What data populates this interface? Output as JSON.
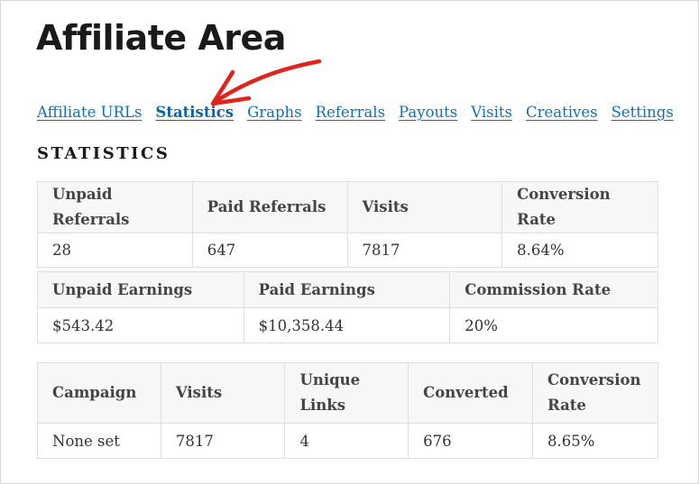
{
  "page": {
    "title": "Affiliate Area",
    "section_heading": "STATISTICS"
  },
  "tabs": [
    {
      "label": "Affiliate URLs",
      "active": false
    },
    {
      "label": "Statistics",
      "active": true
    },
    {
      "label": "Graphs",
      "active": false
    },
    {
      "label": "Referrals",
      "active": false
    },
    {
      "label": "Payouts",
      "active": false
    },
    {
      "label": "Visits",
      "active": false
    },
    {
      "label": "Creatives",
      "active": false
    },
    {
      "label": "Settings",
      "active": false
    }
  ],
  "referral_stats": {
    "headers": [
      "Unpaid Referrals",
      "Paid Referrals",
      "Visits",
      "Conversion Rate"
    ],
    "values": [
      "28",
      "647",
      "7817",
      "8.64%"
    ]
  },
  "earnings_stats": {
    "headers": [
      "Unpaid Earnings",
      "Paid Earnings",
      "Commission Rate"
    ],
    "values": [
      "$543.42",
      "$10,358.44",
      "20%"
    ]
  },
  "campaign_stats": {
    "headers": [
      "Campaign",
      "Visits",
      "Unique Links",
      "Converted",
      "Conversion Rate"
    ],
    "rows": [
      [
        "None set",
        "7817",
        "4",
        "676",
        "8.65%"
      ]
    ]
  },
  "colors": {
    "link": "#0a73b8",
    "annotation_arrow": "#e0231b",
    "table_header_bg": "#f7f7f7",
    "table_border": "#dedede"
  },
  "annotation": {
    "icon": "red-arrow-icon",
    "points_to": "Statistics"
  }
}
